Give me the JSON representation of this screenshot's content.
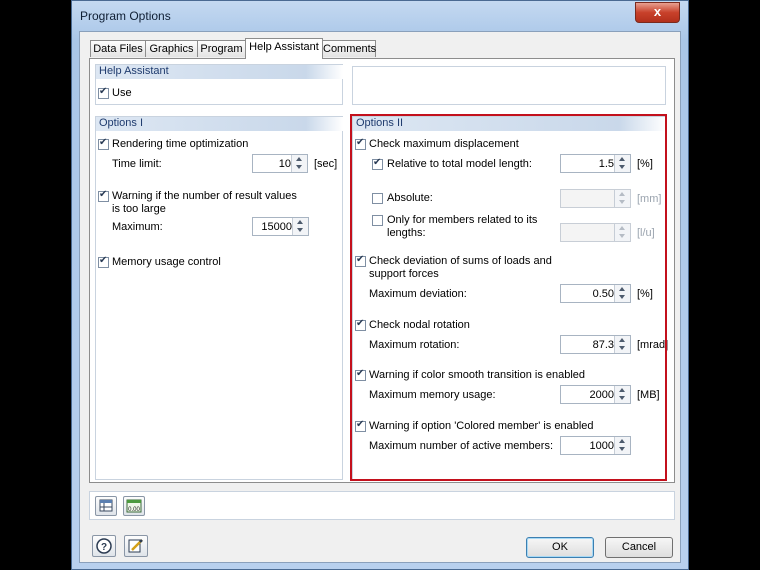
{
  "window": {
    "title": "Program Options",
    "close_glyph": "x"
  },
  "tabs": [
    "Data Files",
    "Graphics",
    "Program",
    "Help Assistant",
    "Comments"
  ],
  "active_tab": "Help Assistant",
  "help_assistant": {
    "header": "Help Assistant",
    "use_label": "Use",
    "use_checked": true
  },
  "options1": {
    "header": "Options I",
    "rendering_label": "Rendering time optimization",
    "time_limit_label": "Time limit:",
    "time_limit_value": "10",
    "time_limit_unit": "[sec]",
    "warning_line1": "Warning if the number of result values",
    "warning_line2": "is too large",
    "maximum_label": "Maximum:",
    "maximum_value": "15000",
    "memory_label": "Memory usage control"
  },
  "options2": {
    "header": "Options II",
    "check_disp_label": "Check maximum displacement",
    "relative_label": "Relative to total model length:",
    "relative_value": "1.5",
    "relative_unit": "[%]",
    "absolute_label": "Absolute:",
    "absolute_value": "",
    "absolute_unit": "[mm]",
    "members_line1": "Only for members related to its",
    "members_line2": "lengths:",
    "members_value": "",
    "members_unit": "[l/u]",
    "deviation_line1": "Check deviation of sums of loads and",
    "deviation_line2": "support forces",
    "max_dev_label": "Maximum deviation:",
    "max_dev_value": "0.50",
    "max_dev_unit": "[%]",
    "nodal_label": "Check nodal rotation",
    "max_rot_label": "Maximum rotation:",
    "max_rot_value": "87.3",
    "max_rot_unit": "[mrad]",
    "color_label": "Warning if color smooth transition is enabled",
    "max_mem_label": "Maximum memory usage:",
    "max_mem_value": "2000",
    "max_mem_unit": "[MB]",
    "colored_label": "Warning if option 'Colored member' is enabled",
    "max_members_label": "Maximum number of active members:",
    "max_members_value": "1000"
  },
  "toolbar": {
    "icon1": "export-table-icon",
    "icon2": "number-format-icon",
    "icon2_text": "0.00"
  },
  "footer": {
    "help_icon": "help-icon",
    "edit_icon": "edit-icon",
    "ok_label": "OK",
    "cancel_label": "Cancel"
  }
}
